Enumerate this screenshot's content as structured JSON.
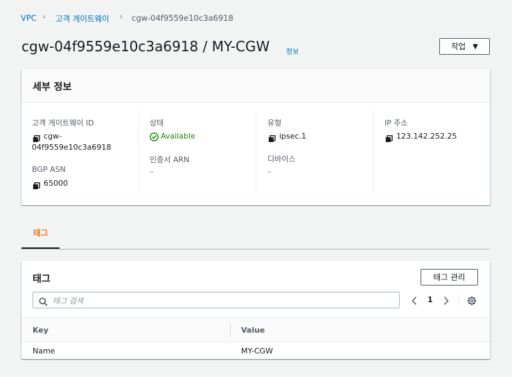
{
  "breadcrumb": {
    "items": [
      "VPC",
      "고객 게이트웨이",
      "cgw-04f9559e10c3a6918"
    ]
  },
  "header": {
    "title": "cgw-04f9559e10c3a6918 / MY-CGW",
    "info_label": "정보",
    "actions_label": "작업"
  },
  "details": {
    "title": "세부 정보",
    "cgw_id_label": "고객 게이트웨이 ID",
    "cgw_id_line1": "cgw-",
    "cgw_id_line2": "04f9559e10c3a6918",
    "bgp_asn_label": "BGP ASN",
    "bgp_asn_value": "65000",
    "state_label": "상태",
    "state_value": "Available",
    "cert_arn_label": "인증서 ARN",
    "cert_arn_value": "–",
    "type_label": "유형",
    "type_value": "ipsec.1",
    "device_label": "디바이스",
    "device_value": "–",
    "ip_label": "IP 주소",
    "ip_value": "123.142.252.25"
  },
  "tabs": {
    "items": [
      "태그"
    ]
  },
  "tags": {
    "title": "태그",
    "manage_label": "태그 관리",
    "search_placeholder": "태그 검색",
    "page": "1",
    "columns": [
      "Key",
      "Value"
    ],
    "rows": [
      {
        "key": "Name",
        "value": "MY-CGW"
      }
    ]
  },
  "colors": {
    "link": "#0073bb",
    "success": "#1d8102",
    "tab_active": "#ec7211"
  },
  "icons": [
    "chevron-right-icon",
    "caret-down-icon",
    "copy-icon",
    "check-circle-icon",
    "search-icon",
    "chevron-left-icon",
    "gear-icon"
  ]
}
